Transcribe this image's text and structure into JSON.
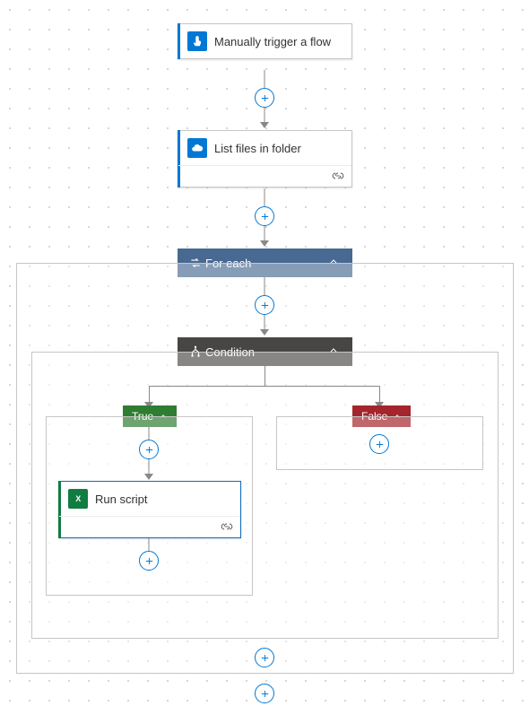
{
  "trigger": {
    "title": "Manually trigger a flow",
    "icon": "touch-icon",
    "accent": "#0078d4",
    "iconbg": "#0078d4"
  },
  "action_list": {
    "title": "List files in folder",
    "icon": "cloud-icon",
    "accent": "#0078d4",
    "iconbg": "#0078d4"
  },
  "foreach": {
    "label": "For each",
    "icon": "loop-icon"
  },
  "condition": {
    "label": "Condition",
    "icon": "condition-icon"
  },
  "branch_true": {
    "label": "True"
  },
  "branch_false": {
    "label": "False"
  },
  "action_script": {
    "title": "Run script",
    "icon": "excel-icon",
    "accent": "#107c41"
  }
}
